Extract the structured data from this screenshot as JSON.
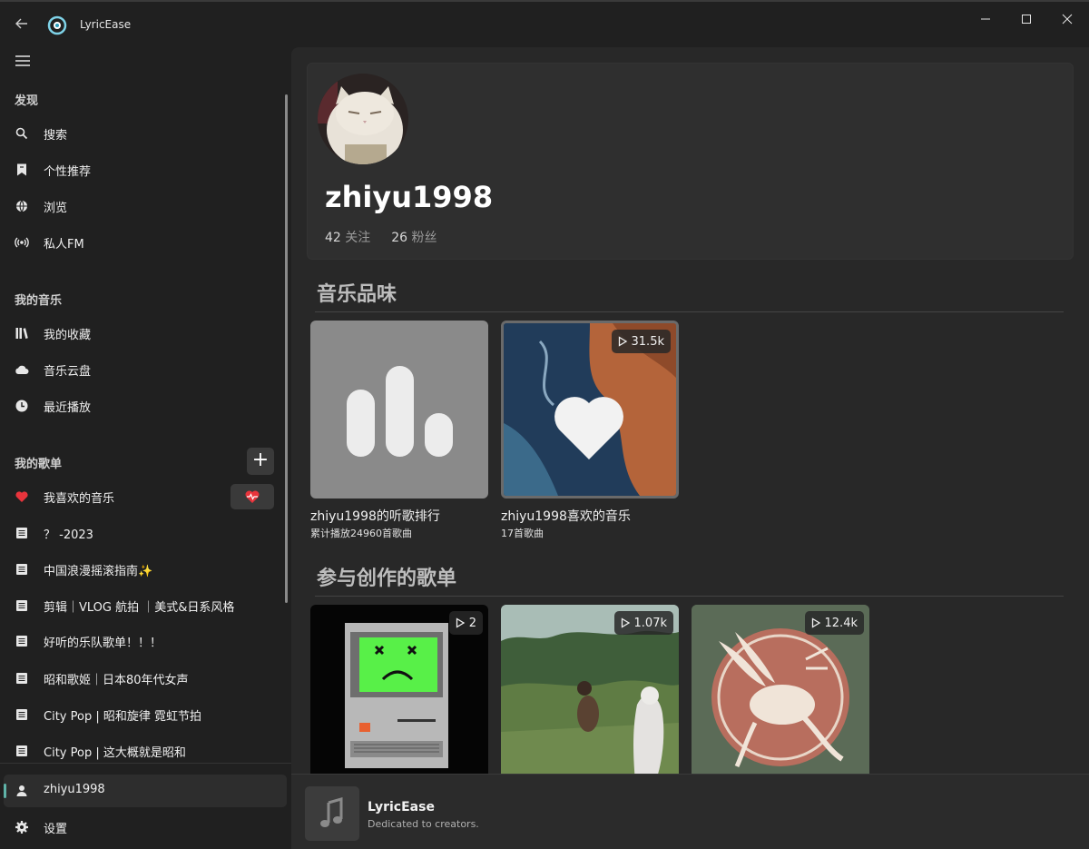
{
  "window": {
    "app_title": "LyricEase",
    "back_icon": "arrow-left-icon",
    "controls": [
      "minimize-icon",
      "maximize-icon",
      "close-icon"
    ]
  },
  "sidebar": {
    "menu_icon": "hamburger-icon",
    "discover": {
      "heading": "发现",
      "items": [
        {
          "label": "搜索",
          "icon": "search-icon"
        },
        {
          "label": "个性推荐",
          "icon": "bookmark-icon"
        },
        {
          "label": "浏览",
          "icon": "globe-icon"
        },
        {
          "label": "私人FM",
          "icon": "radio-icon"
        }
      ]
    },
    "my_music": {
      "heading": "我的音乐",
      "items": [
        {
          "label": "我的收藏",
          "icon": "library-icon"
        },
        {
          "label": "音乐云盘",
          "icon": "cloud-icon"
        },
        {
          "label": "最近播放",
          "icon": "clock-icon"
        }
      ]
    },
    "playlists": {
      "heading": "我的歌单",
      "add_label": "+",
      "items": [
        {
          "label": "我喜欢的音乐",
          "icon": "heart-icon"
        },
        {
          "label": "？ -2023",
          "icon": "list-icon"
        },
        {
          "label": "中国浪漫摇滚指南✨",
          "icon": "list-icon"
        },
        {
          "label": "剪辑｜VLOG 航拍 ｜美式&日系风格",
          "icon": "list-icon"
        },
        {
          "label": "好听的乐队歌单！！！",
          "icon": "list-icon"
        },
        {
          "label": "昭和歌姬｜日本80年代女声",
          "icon": "list-icon"
        },
        {
          "label": "City Pop | 昭和旋律 霓虹节拍",
          "icon": "list-icon"
        },
        {
          "label": "City Pop | 这大概就是昭和",
          "icon": "list-icon"
        }
      ]
    },
    "bottom": [
      {
        "label": "zhiyu1998",
        "icon": "person-icon"
      },
      {
        "label": "设置",
        "icon": "gear-icon"
      }
    ],
    "accent": "#5fb3a8"
  },
  "profile": {
    "username": "zhiyu1998",
    "following_count": "42",
    "following_label": "关注",
    "followers_count": "26",
    "followers_label": "粉丝"
  },
  "music_taste": {
    "heading": "音乐品味",
    "tiles": [
      {
        "title": "zhiyu1998的听歌排行",
        "subtitle": "累计播放24960首歌曲"
      },
      {
        "title": "zhiyu1998喜欢的音乐",
        "subtitle": "17首歌曲",
        "plays": "31.5k"
      }
    ]
  },
  "created_playlists": {
    "heading": "参与创作的歌单",
    "tiles": [
      {
        "plays": "2"
      },
      {
        "plays": "1.07k"
      },
      {
        "plays": "12.4k"
      }
    ]
  },
  "player": {
    "title": "LyricEase",
    "subtitle": "Dedicated to creators.",
    "cover_icon": "music-note-icon"
  }
}
